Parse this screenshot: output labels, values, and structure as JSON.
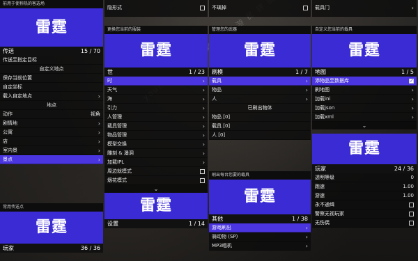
{
  "colors": {
    "accent": "#4a35e0",
    "banner": "#3a2bd4",
    "row": "#0c0c0c"
  },
  "watermark": "youmintong.cn 新 传 猫 游 民 拼 图",
  "col1": {
    "top_header": "前用于使称热的客选场",
    "banner": "雷霆",
    "title": "传送",
    "count": "15 / 70",
    "rows": [
      {
        "label": "传送至指定目标",
        "right": ""
      },
      {
        "label": "自定义地点",
        "right": ""
      },
      {
        "label": "保存当前位置",
        "right": ""
      },
      {
        "label": "自定坐标",
        "right": ""
      },
      {
        "label": "载入自定地点",
        "right": "›"
      },
      {
        "label": "地点",
        "right": ""
      },
      {
        "label": "动作",
        "right": "视角"
      },
      {
        "label": "剧情地",
        "right": "›"
      },
      {
        "label": "公寓",
        "right": "›"
      },
      {
        "label": "店",
        "right": "›"
      },
      {
        "label": "室内景",
        "right": "›"
      },
      {
        "label": "景点",
        "right": "›"
      }
    ],
    "bottom_header": "常用传送点",
    "bottom_banner": "雷霆",
    "bottom_title": "玩家",
    "bottom_count": "36 / 36"
  },
  "col2": {
    "top_row": {
      "label": "隐形式",
      "right": "box"
    },
    "header": "更换您当前的服装",
    "banner": "雷霆",
    "title": "世",
    "count": "1 / 23",
    "rows": [
      {
        "label": "时",
        "right": "›",
        "sel": true
      },
      {
        "label": "天气",
        "right": "›"
      },
      {
        "label": "海",
        "right": "›"
      },
      {
        "label": "引力",
        "right": "›"
      },
      {
        "label": "人管理",
        "right": "›"
      },
      {
        "label": "载具管理",
        "right": "›"
      },
      {
        "label": "物品管理",
        "right": "›"
      },
      {
        "label": "模型交换",
        "right": "›"
      },
      {
        "label": "雕刻 & 瀑洞",
        "right": "›"
      },
      {
        "label": "加载IPL",
        "right": "›"
      },
      {
        "label": "周边就模式",
        "right": "box"
      },
      {
        "label": "烟花模式",
        "right": "box"
      }
    ],
    "chevron": "⌄",
    "bottom_banner": "雷霆",
    "bottom_title": "设置",
    "bottom_count": "1 / 14"
  },
  "col3": {
    "top_row": {
      "label": "不璃掉",
      "right": "box"
    },
    "header": "管理您的武器",
    "banner": "雷霆",
    "title": "刷模",
    "count": "1 / 7",
    "rows": [
      {
        "label": "载具",
        "right": "›",
        "sel": true
      },
      {
        "label": "物品",
        "right": "›"
      },
      {
        "label": "人",
        "right": "›"
      },
      {
        "label": "已刷出物体",
        "right": "",
        "center": true
      },
      {
        "label": "物品 [0]",
        "right": ""
      },
      {
        "label": "载具 [0]",
        "right": ""
      },
      {
        "label": "人 [0]",
        "right": ""
      }
    ],
    "bottom_header": "刷出每台您要的载具",
    "bottom_banner": "雷霆",
    "bottom_title": "其他",
    "bottom_count": "1 / 38",
    "bottom_rows": [
      {
        "label": "游戏刷出",
        "right": "›",
        "sel": true
      },
      {
        "label": "骑动物 (SP)",
        "right": "›"
      },
      {
        "label": "MP3唱机",
        "right": "›"
      }
    ]
  },
  "col4": {
    "top_row": {
      "label": "载具门",
      "right": "›"
    },
    "header": "自定义您当前的载具",
    "banner": "雷霆",
    "title": "地图",
    "count": "1 / 5",
    "rows": [
      {
        "label": "添物品至数据库",
        "right": "checked",
        "sel": true
      },
      {
        "label": "刷地图",
        "right": "›"
      },
      {
        "label": "加载ini",
        "right": "›"
      },
      {
        "label": "加载json",
        "right": "›"
      },
      {
        "label": "加载xml",
        "right": "›"
      }
    ],
    "chevron": "⌄",
    "bottom_banner": "雷霆",
    "bottom_title": "玩家",
    "bottom_count": "24 / 36",
    "bottom_rows": [
      {
        "label": "透明等级",
        "right": "0"
      },
      {
        "label": "跑速",
        "right": "1.00"
      },
      {
        "label": "游速",
        "right": "1.00"
      },
      {
        "label": "永不通缉",
        "right": "box"
      },
      {
        "label": "警察无视玩家",
        "right": "box"
      },
      {
        "label": "无伤偶",
        "right": "box"
      }
    ]
  }
}
